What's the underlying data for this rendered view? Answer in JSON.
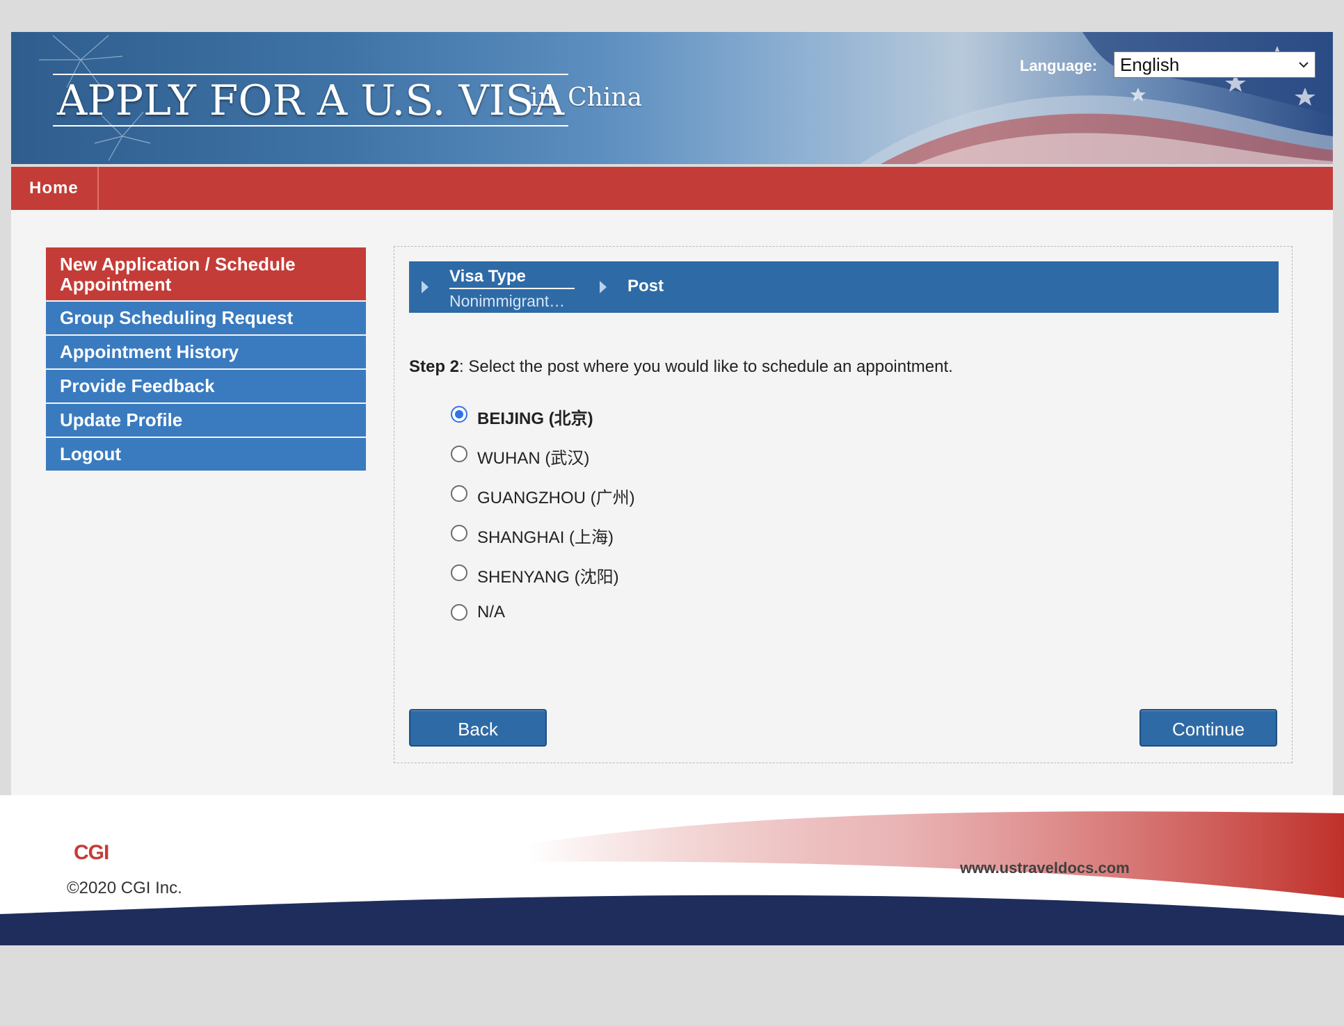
{
  "header": {
    "title": "APPLY FOR A U.S. VISA",
    "subtitle": "in China",
    "language_label": "Language:",
    "language_value": "English"
  },
  "navbar": {
    "home": "Home"
  },
  "sidebar": {
    "items": [
      {
        "label": "New Application / Schedule Appointment",
        "active": true
      },
      {
        "label": "Group Scheduling Request"
      },
      {
        "label": "Appointment History"
      },
      {
        "label": "Provide Feedback"
      },
      {
        "label": "Update Profile"
      },
      {
        "label": "Logout"
      }
    ]
  },
  "breadcrumb": {
    "visa_type_label": "Visa Type",
    "visa_type_value": "Nonimmigrant…",
    "post_label": "Post"
  },
  "step": {
    "prefix": "Step 2",
    "text": ": Select the post where you would like to schedule an appointment."
  },
  "posts": {
    "selected": "BEIJING (北京)",
    "options": [
      "BEIJING (北京)",
      "WUHAN (武汉)",
      "GUANGZHOU (广州)",
      "SHANGHAI (上海)",
      "SHENYANG (沈阳)",
      "N/A"
    ]
  },
  "buttons": {
    "back": "Back",
    "continue": "Continue"
  },
  "footer": {
    "logo": "CGI",
    "copyright": "©2020 CGI Inc.",
    "url": "www.ustraveldocs.com"
  },
  "colors": {
    "nav_red": "#c43c37",
    "sidebar_blue": "#3a7bbf",
    "breadcrumb_blue": "#2e6aa6",
    "footer_navy": "#1f2d5c",
    "radio_checked": "#2f73e6"
  }
}
